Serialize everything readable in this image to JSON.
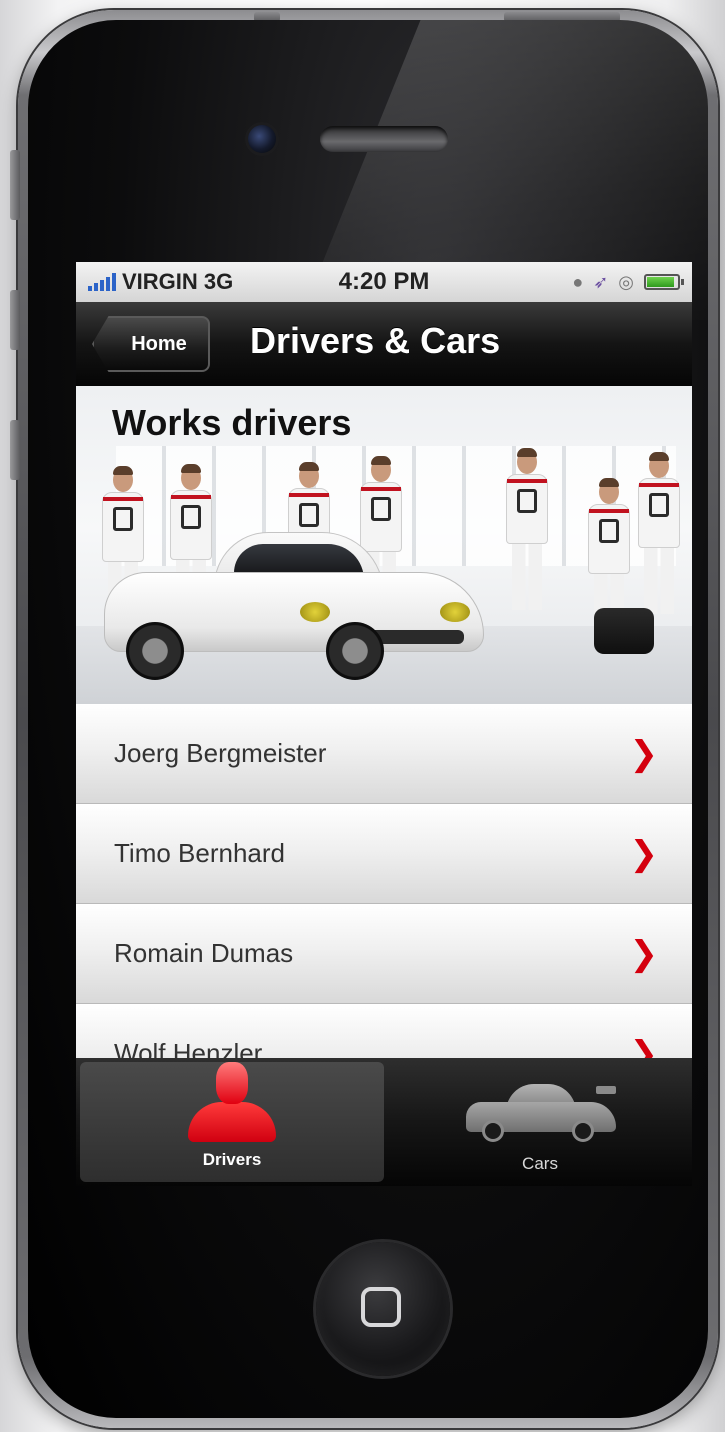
{
  "status_bar": {
    "carrier": "VIRGIN 3G",
    "time": "4:20 PM",
    "battery_level": 0.85
  },
  "nav": {
    "back_label": "Home",
    "title": "Drivers & Cars"
  },
  "hero": {
    "title": "Works drivers"
  },
  "drivers": [
    {
      "name": "Joerg Bergmeister"
    },
    {
      "name": "Timo Bernhard"
    },
    {
      "name": "Romain Dumas"
    },
    {
      "name": "Wolf Henzler"
    }
  ],
  "tabs": [
    {
      "label": "Drivers",
      "icon": "person-icon",
      "active": true
    },
    {
      "label": "Cars",
      "icon": "car-icon",
      "active": false
    }
  ],
  "colors": {
    "accent_red": "#d4000e",
    "signal_blue": "#2b63c8"
  }
}
